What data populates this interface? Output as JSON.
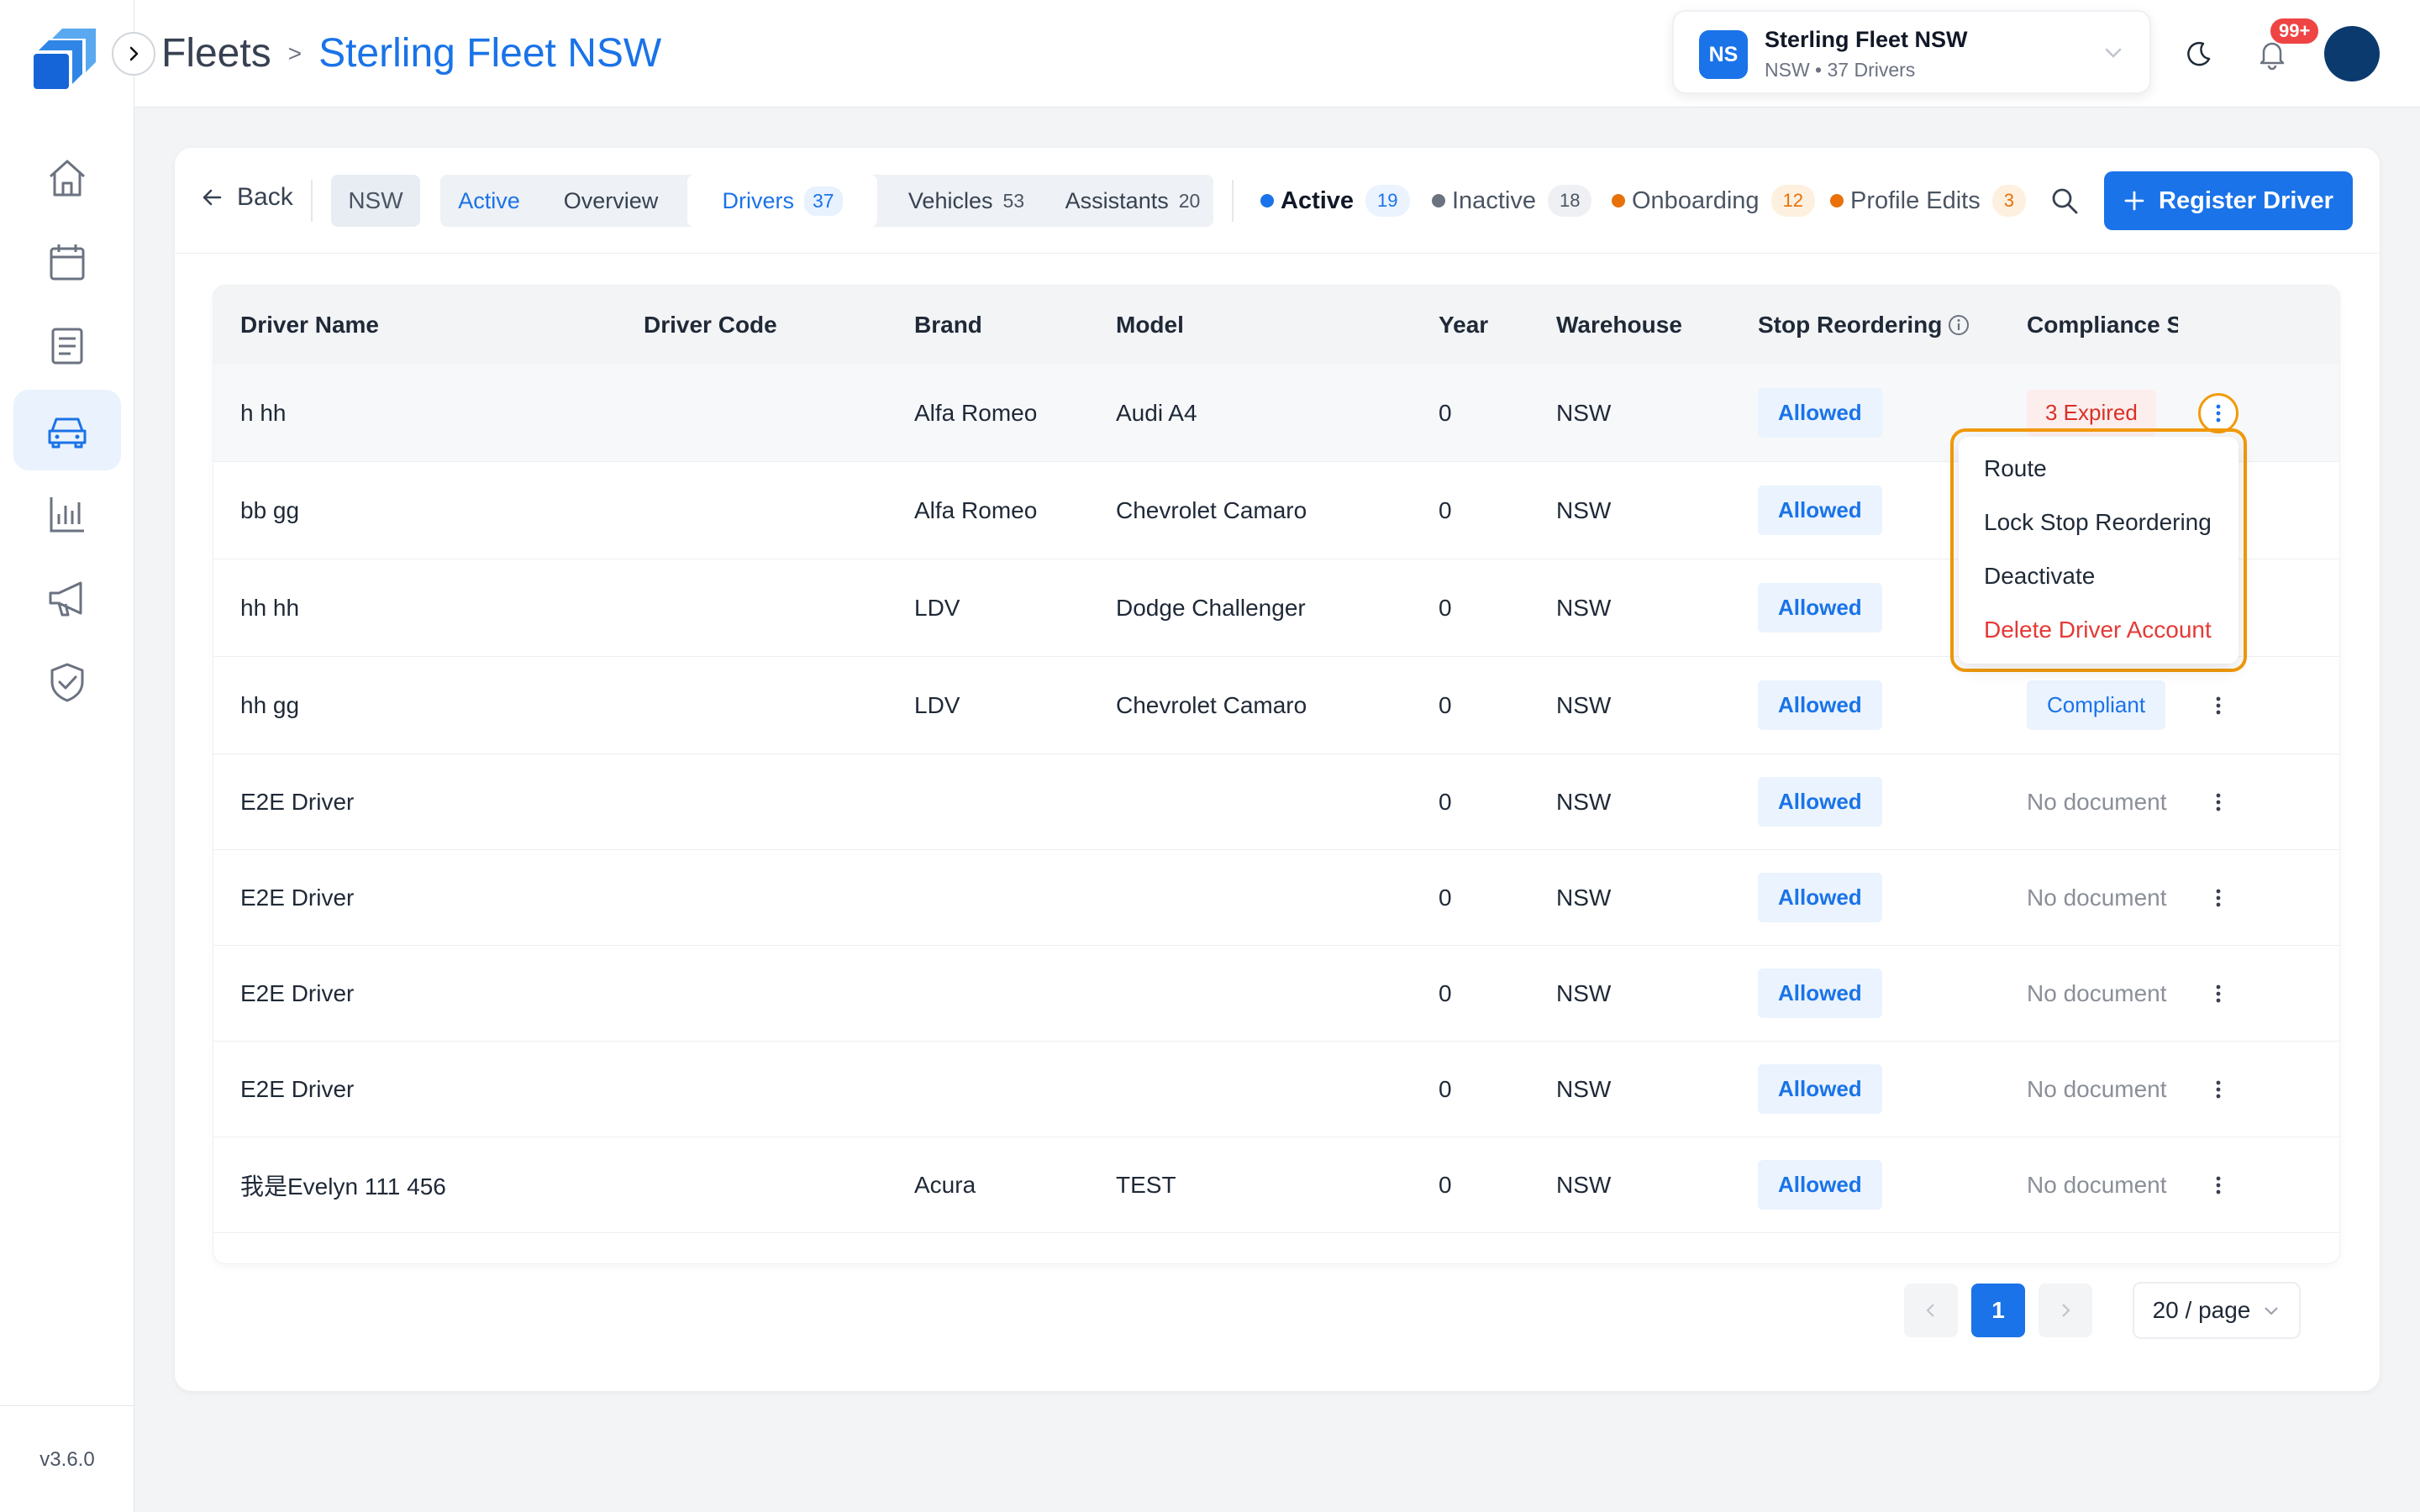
{
  "app": {
    "version": "v3.6.0",
    "accent_color": "#1a73e8"
  },
  "sidebar": {
    "items": [
      {
        "name": "home-icon"
      },
      {
        "name": "calendar-icon"
      },
      {
        "name": "document-icon"
      },
      {
        "name": "car-icon",
        "active": true
      },
      {
        "name": "bar-chart-icon"
      },
      {
        "name": "megaphone-icon"
      },
      {
        "name": "shield-check-icon"
      }
    ]
  },
  "header": {
    "breadcrumb_root": "Fleets",
    "breadcrumb_sep": ">",
    "breadcrumb_current": "Sterling Fleet NSW",
    "fleet_switcher": {
      "initials": "NS",
      "name": "Sterling Fleet NSW",
      "subtitle": "NSW • 37 Drivers"
    },
    "notifications_badge": "99+"
  },
  "toolbar": {
    "back_label": "Back",
    "region": "NSW",
    "tabs": [
      {
        "label": "Active"
      },
      {
        "label": "Overview"
      },
      {
        "label": "Drivers",
        "count": "37"
      },
      {
        "label": "Vehicles",
        "count": "53"
      },
      {
        "label": "Assistants",
        "count": "20"
      }
    ],
    "status_filters": [
      {
        "label": "Active",
        "count": "19",
        "color": "#1a73e8"
      },
      {
        "label": "Inactive",
        "count": "18",
        "color": "#6b7280"
      },
      {
        "label": "Onboarding",
        "count": "12",
        "color": "#e8710a"
      },
      {
        "label": "Profile Edits",
        "count": "3",
        "color": "#e8710a"
      }
    ],
    "register_label": "Register Driver"
  },
  "table": {
    "columns": [
      "Driver Name",
      "Driver Code",
      "Brand",
      "Model",
      "Year",
      "Warehouse",
      "Stop Reordering",
      "Compliance S"
    ],
    "rows": [
      {
        "name": "h hh",
        "code": "",
        "brand": "Alfa Romeo",
        "model": "Audi A4",
        "year": "0",
        "warehouse": "NSW",
        "stop": "Allowed",
        "compliance": "3 Expired"
      },
      {
        "name": "bb gg",
        "code": "",
        "brand": "Alfa Romeo",
        "model": "Chevrolet Camaro",
        "year": "0",
        "warehouse": "NSW",
        "stop": "Allowed",
        "compliance": ""
      },
      {
        "name": "hh hh",
        "code": "",
        "brand": "LDV",
        "model": "Dodge Challenger",
        "year": "0",
        "warehouse": "NSW",
        "stop": "Allowed",
        "compliance": ""
      },
      {
        "name": "hh gg",
        "code": "",
        "brand": "LDV",
        "model": "Chevrolet Camaro",
        "year": "0",
        "warehouse": "NSW",
        "stop": "Allowed",
        "compliance": "Compliant"
      },
      {
        "name": "E2E Driver",
        "code": "",
        "brand": "",
        "model": "",
        "year": "0",
        "warehouse": "NSW",
        "stop": "Allowed",
        "compliance": "No document"
      },
      {
        "name": "E2E Driver",
        "code": "",
        "brand": "",
        "model": "",
        "year": "0",
        "warehouse": "NSW",
        "stop": "Allowed",
        "compliance": "No document"
      },
      {
        "name": "E2E Driver",
        "code": "",
        "brand": "",
        "model": "",
        "year": "0",
        "warehouse": "NSW",
        "stop": "Allowed",
        "compliance": "No document"
      },
      {
        "name": "E2E Driver",
        "code": "",
        "brand": "",
        "model": "",
        "year": "0",
        "warehouse": "NSW",
        "stop": "Allowed",
        "compliance": "No document"
      },
      {
        "name": "我是Evelyn 111 456",
        "code": "",
        "brand": "Acura",
        "model": "TEST",
        "year": "0",
        "warehouse": "NSW",
        "stop": "Allowed",
        "compliance": "No document"
      }
    ]
  },
  "context_menu": {
    "items": [
      "Route",
      "Lock Stop Reordering",
      "Deactivate",
      "Delete Driver Account"
    ]
  },
  "pagination": {
    "current_page": "1",
    "page_size": "20 / page"
  }
}
